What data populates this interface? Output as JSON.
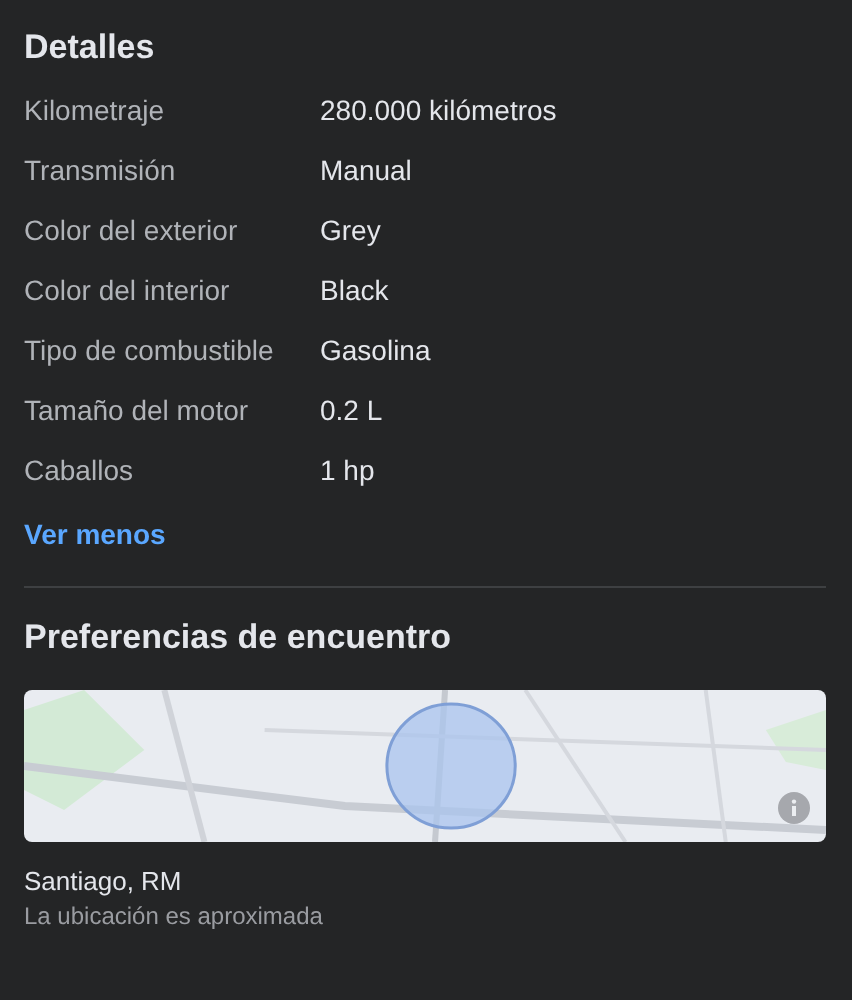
{
  "details": {
    "title": "Detalles",
    "rows": [
      {
        "label": "Kilometraje",
        "value": "280.000 kilómetros"
      },
      {
        "label": "Transmisión",
        "value": "Manual"
      },
      {
        "label": "Color del exterior",
        "value": "Grey"
      },
      {
        "label": "Color del interior",
        "value": "Black"
      },
      {
        "label": "Tipo de combustible",
        "value": "Gasolina"
      },
      {
        "label": "Tamaño del motor",
        "value": "0.2 L"
      },
      {
        "label": "Caballos",
        "value": "1 hp"
      }
    ],
    "toggle_link": "Ver menos"
  },
  "meeting": {
    "title": "Preferencias de encuentro",
    "location": "Santiago, RM",
    "note": "La ubicación es aproximada"
  }
}
